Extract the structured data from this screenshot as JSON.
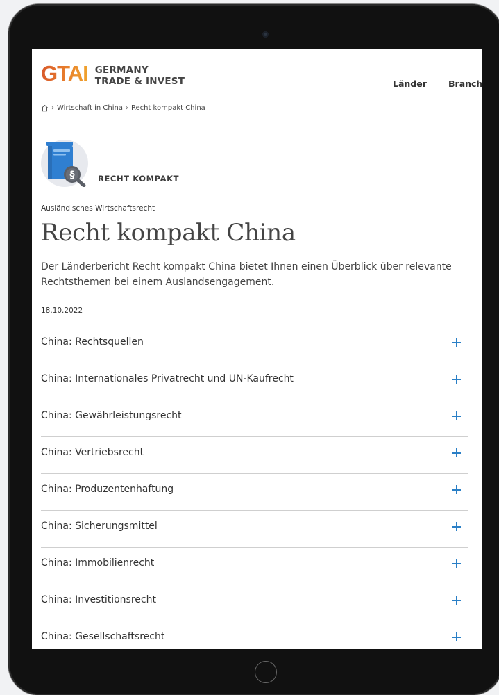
{
  "logo": {
    "mark": "GTAI",
    "line1": "GERMANY",
    "line2": "TRADE & INVEST"
  },
  "nav": {
    "items": [
      "Länder",
      "Branche"
    ]
  },
  "breadcrumb": {
    "items": [
      "Wirtschaft in China",
      "Recht kompakt China"
    ]
  },
  "badge": {
    "label": "RECHT KOMPAKT"
  },
  "article": {
    "overline": "Ausländisches Wirtschaftsrecht",
    "title": "Recht kompakt China",
    "lead": "Der Länderbericht Recht kompakt China bietet Ihnen einen Überblick über relevante Rechtsthemen bei einem Auslandsengagement.",
    "date": "18.10.2022"
  },
  "accordion": {
    "items": [
      "China: Rechtsquellen",
      "China: Internationales Privatrecht und UN-Kaufrecht",
      "China: Gewährleistungsrecht",
      "China: Vertriebsrecht",
      "China: Produzentenhaftung",
      "China: Sicherungsmittel",
      "China: Immobilienrecht",
      "China: Investitionsrecht",
      "China: Gesellschaftsrecht"
    ]
  },
  "colors": {
    "accent_blue": "#2a7fc6",
    "logo_orange": "#e6782c",
    "text_dark": "#444444",
    "icon_blue": "#2f7fd1"
  }
}
